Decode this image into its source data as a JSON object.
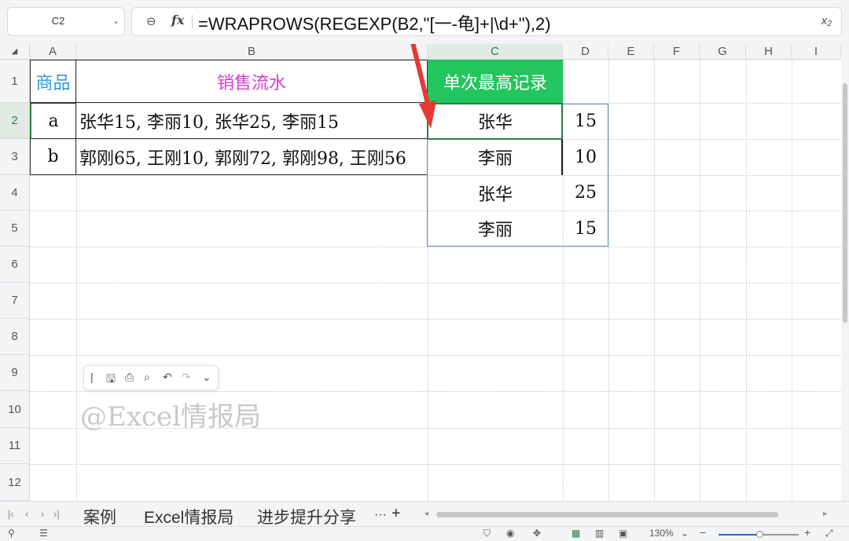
{
  "name_box": {
    "ref": "C2"
  },
  "formula_bar": {
    "formula": "=WRAPROWS(REGEXP(B2,\"[一-龟]+|\\d+\"),2)"
  },
  "columns": [
    "A",
    "B",
    "C",
    "D",
    "E",
    "F",
    "G",
    "H",
    "I"
  ],
  "rows": [
    "1",
    "2",
    "3",
    "4",
    "5",
    "6",
    "7",
    "8",
    "9",
    "10",
    "11",
    "12"
  ],
  "cells": {
    "a1": "商品",
    "b1": "销售流水",
    "c1": "单次最高记录",
    "a2": "a",
    "b2": "张华15, 李丽10, 张华25, 李丽15",
    "a3": "b",
    "b3": "郭刚65, 王刚10, 郭刚72, 郭刚98, 王刚56",
    "c2": "张华",
    "d2": "15",
    "c3": "李丽",
    "d3": "10",
    "c4": "张华",
    "d4": "25",
    "c5": "李丽",
    "d5": "15"
  },
  "colors": {
    "header_a": "#2e9bd6",
    "header_b": "#d63ad6",
    "header_c_bg": "#22c55e",
    "selection": "#2e7d4a",
    "arrow": "#e53935",
    "spill_border": "#5b8fd6"
  },
  "watermark": "@Excel情报局",
  "sheet_tabs": [
    "案例",
    "Excel情报局",
    "进步提升分享"
  ],
  "tab_more": "···",
  "tab_add": "+",
  "status": {
    "zoom": "130%",
    "zoom_level_percent": 51
  }
}
